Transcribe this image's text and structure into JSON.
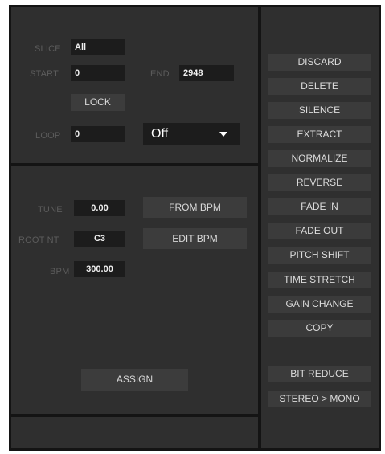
{
  "slice": {
    "label": "SLICE",
    "value": "All"
  },
  "start": {
    "label": "START",
    "value": "0"
  },
  "end": {
    "label": "END",
    "value": "2948"
  },
  "lock_label": "LOCK",
  "loop": {
    "label": "LOOP",
    "value": "0",
    "mode": "Off"
  },
  "tune": {
    "label": "TUNE",
    "value": "0.00"
  },
  "root_note": {
    "label": "ROOT NT",
    "value": "C3"
  },
  "bpm": {
    "label": "BPM",
    "value": "300.00"
  },
  "from_bpm_label": "FROM BPM",
  "edit_bpm_label": "EDIT BPM",
  "assign_label": "ASSIGN",
  "actions": [
    "DISCARD",
    "DELETE",
    "SILENCE",
    "EXTRACT",
    "NORMALIZE",
    "REVERSE",
    "FADE IN",
    "FADE OUT",
    "PITCH SHIFT",
    "TIME STRETCH",
    "GAIN CHANGE",
    "COPY"
  ],
  "extra_actions": [
    "BIT REDUCE",
    "STEREO > MONO"
  ],
  "colors": {
    "panel": "#2f2f2f",
    "field": "#1c1c1c",
    "button": "#3b3b3b",
    "border": "#141414"
  }
}
